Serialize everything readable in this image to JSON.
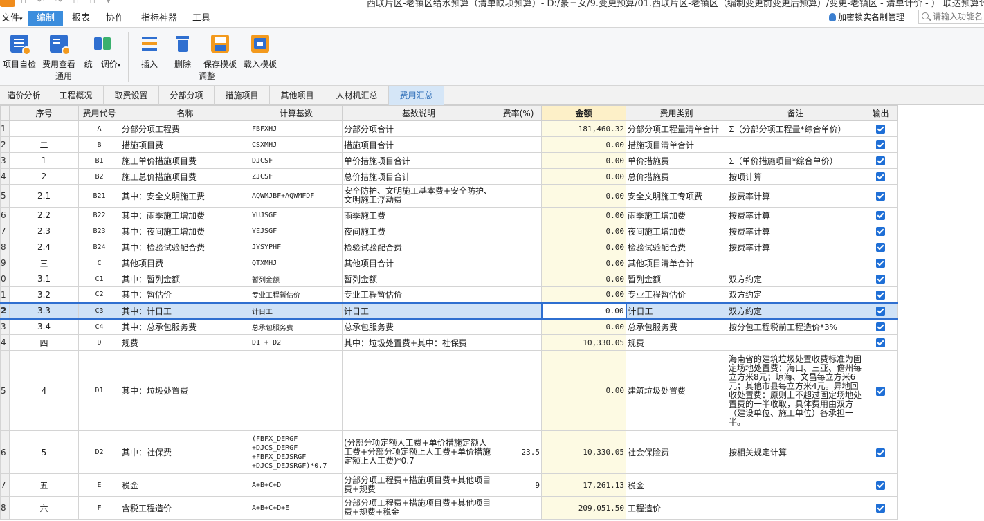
{
  "window": {
    "title": "西联片区-老镇区给水预算（清单缺项预算）- D:/豪三女/9.变更预算/01.西联片区-老镇区（编制变更前变更后预算）/变更-老镇区 - 清单计价 - ）  联达预算计价"
  },
  "menu": {
    "items": [
      {
        "label": "文件",
        "arrow": "▾"
      },
      {
        "label": "编制"
      },
      {
        "label": "报表"
      },
      {
        "label": "协作"
      },
      {
        "label": "指标神器"
      },
      {
        "label": "工具"
      }
    ],
    "encrypt_label": "加密锁实名制管理",
    "search_placeholder": "请输入功能名"
  },
  "ribbon": {
    "group1": {
      "label": "通用",
      "buttons": [
        {
          "label": "项目自检",
          "icon": "check-doc-icon"
        },
        {
          "label": "费用查看",
          "icon": "fee-view-icon"
        },
        {
          "label": "统一调价",
          "arrow": "▾",
          "icon": "price-adjust-icon"
        }
      ]
    },
    "group2": {
      "label": "调整",
      "buttons": [
        {
          "label": "插入",
          "icon": "insert-icon"
        },
        {
          "label": "删除",
          "icon": "delete-icon"
        },
        {
          "label": "保存模板",
          "icon": "save-template-icon"
        },
        {
          "label": "载入模板",
          "icon": "load-template-icon"
        }
      ]
    }
  },
  "sheet_tabs": [
    "造价分析",
    "工程概况",
    "取费设置",
    "分部分项",
    "措施项目",
    "其他项目",
    "人材机汇总",
    "费用汇总"
  ],
  "active_tab": "费用汇总",
  "table": {
    "columns": [
      "序号",
      "费用代号",
      "名称",
      "计算基数",
      "基数说明",
      "费率(%)",
      "金额",
      "费用类别",
      "备注",
      "输出"
    ],
    "rows": [
      {
        "rn": "1",
        "seq": "一",
        "code": "A",
        "name": "分部分项工程费",
        "base": "FBFXHJ",
        "desc": "分部分项合计",
        "rate": "",
        "amount": "181,460.32",
        "cat": "分部分项工程量清单合计",
        "note": "Σ（分部分项工程量*综合单价）",
        "output": true
      },
      {
        "rn": "2",
        "seq": "二",
        "code": "B",
        "name": "措施项目费",
        "base": "CSXMHJ",
        "desc": "措施项目合计",
        "rate": "",
        "amount": "0.00",
        "cat": "措施项目清单合计",
        "note": "",
        "output": true
      },
      {
        "rn": "3",
        "seq": "1",
        "code": "B1",
        "name": "施工单价措施项目费",
        "base": "DJCSF",
        "desc": "单价措施项目合计",
        "rate": "",
        "amount": "0.00",
        "cat": "单价措施费",
        "note": "Σ（单价措施项目*综合单价）",
        "output": true
      },
      {
        "rn": "4",
        "seq": "2",
        "code": "B2",
        "name": "施工总价措施项目费",
        "base": "ZJCSF",
        "desc": "总价措施项目合计",
        "rate": "",
        "amount": "0.00",
        "cat": "总价措施费",
        "note": "按项计算",
        "output": true
      },
      {
        "rn": "5",
        "seq": "2.1",
        "code": "B21",
        "name": "其中：安全文明施工费",
        "base": "AQWMJBF+AQWMFDF",
        "desc": "安全防护、文明施工基本费+安全防护、文明施工浮动费",
        "rate": "",
        "amount": "0.00",
        "cat": "安全文明施工专项费",
        "note": "按费率计算",
        "output": true
      },
      {
        "rn": "6",
        "seq": "2.2",
        "code": "B22",
        "name": "其中：雨季施工增加费",
        "base": "YUJSGF",
        "desc": "雨季施工费",
        "rate": "",
        "amount": "0.00",
        "cat": "雨季施工增加费",
        "note": "按费率计算",
        "output": true
      },
      {
        "rn": "7",
        "seq": "2.3",
        "code": "B23",
        "name": "其中：夜间施工增加费",
        "base": "YEJSGF",
        "desc": "夜间施工费",
        "rate": "",
        "amount": "0.00",
        "cat": "夜间施工增加费",
        "note": "按费率计算",
        "output": true
      },
      {
        "rn": "8",
        "seq": "2.4",
        "code": "B24",
        "name": "其中：检验试验配合费",
        "base": "JYSYPHF",
        "desc": "检验试验配合费",
        "rate": "",
        "amount": "0.00",
        "cat": "检验试验配合费",
        "note": "按费率计算",
        "output": true
      },
      {
        "rn": "9",
        "seq": "三",
        "code": "C",
        "name": "其他项目费",
        "base": "QTXMHJ",
        "desc": "其他项目合计",
        "rate": "",
        "amount": "0.00",
        "cat": "其他项目清单合计",
        "note": "",
        "output": true
      },
      {
        "rn": "0",
        "seq": "3.1",
        "code": "C1",
        "name": "其中：暂列金额",
        "base": "暂列金额",
        "desc": "暂列金额",
        "rate": "",
        "amount": "0.00",
        "cat": "暂列金额",
        "note": "双方约定",
        "output": true
      },
      {
        "rn": "1",
        "seq": "3.2",
        "code": "C2",
        "name": "其中：暂估价",
        "base": "专业工程暂估价",
        "desc": "专业工程暂估价",
        "rate": "",
        "amount": "0.00",
        "cat": "专业工程暂估价",
        "note": "双方约定",
        "output": true
      },
      {
        "rn": "2",
        "seq": "3.3",
        "code": "C3",
        "name": "其中：计日工",
        "base": "计日工",
        "desc": "计日工",
        "rate": "",
        "amount": "0.00",
        "cat": "计日工",
        "note": "双方约定",
        "output": true
      },
      {
        "rn": "3",
        "seq": "3.4",
        "code": "C4",
        "name": "其中：总承包服务费",
        "base": "总承包服务费",
        "desc": "总承包服务费",
        "rate": "",
        "amount": "0.00",
        "cat": "总承包服务费",
        "note": "按分包工程税前工程造价*3%",
        "output": true
      },
      {
        "rn": "4",
        "seq": "四",
        "code": "D",
        "name": "规费",
        "base": "D1 + D2",
        "desc": "其中：垃圾处置费+其中：社保费",
        "rate": "",
        "amount": "10,330.05",
        "cat": "规费",
        "note": "",
        "output": true
      },
      {
        "rn": "5",
        "seq": "4",
        "code": "D1",
        "name": "其中：垃圾处置费",
        "base": "",
        "desc": "",
        "rate": "",
        "amount": "0.00",
        "cat": "建筑垃圾处置费",
        "note": "海南省的建筑垃圾处置收费标准为固定场地处置费：海口、三亚、儋州每立方米8元；琼海、文昌每立方米6元；其他市县每立方米4元。异地回收处置费：原则上不超过固定场地处置费的一半收取，具体费用由双方（建设单位、施工单位）各承担一半。",
        "output": true
      },
      {
        "rn": "6",
        "seq": "5",
        "code": "D2",
        "name": "其中：社保费",
        "base": "(FBFX_DERGF +DJCS_DERGF +FBFX_DEJSRGF +DJCS_DEJSRGF)*0.7",
        "desc": "(分部分项定额人工费+单价措施定额人工费+分部分项定额上人工费+单价措施定额上人工费)*0.7",
        "rate": "23.5",
        "amount": "10,330.05",
        "cat": "社会保险费",
        "note": "按相关规定计算",
        "output": true
      },
      {
        "rn": "7",
        "seq": "五",
        "code": "E",
        "name": "税金",
        "base": "A+B+C+D",
        "desc": "分部分项工程费+措施项目费+其他项目费+规费",
        "rate": "9",
        "amount": "17,261.13",
        "cat": "税金",
        "note": "",
        "output": true
      },
      {
        "rn": "8",
        "seq": "六",
        "code": "F",
        "name": "含税工程造价",
        "base": "A+B+C+D+E",
        "desc": "分部分项工程费+措施项目费+其他项目费+规费+税金",
        "rate": "",
        "amount": "209,051.50",
        "cat": "工程造价",
        "note": "",
        "output": true
      }
    ]
  },
  "colors": {
    "accent": "#3b8ddd",
    "selection": "#cfe2f7",
    "amount_header": "#fdf0c8",
    "checkbox": "#1f6fd6"
  }
}
